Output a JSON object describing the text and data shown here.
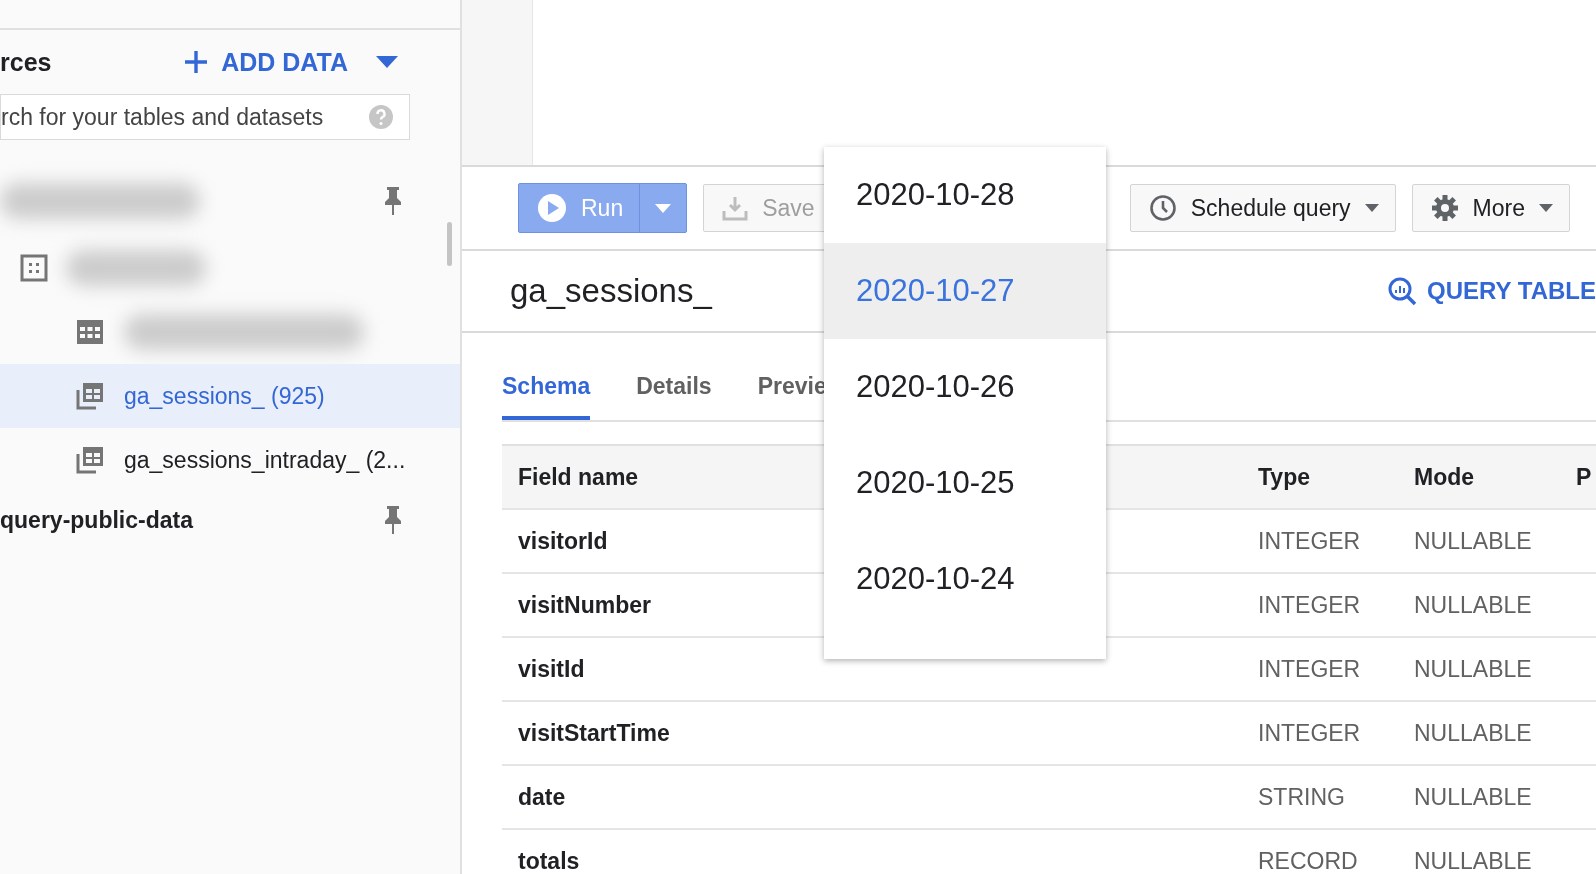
{
  "sidebar": {
    "title": "rces",
    "add_data": "ADD DATA",
    "search": {
      "placeholder": "rch for your tables and datasets"
    },
    "items": [
      {
        "kind": "project",
        "pinned": true,
        "blurred": true,
        "children": [
          {
            "kind": "dataset",
            "blurred": true,
            "children": [
              {
                "kind": "table",
                "blurred": true,
                "selected": false
              },
              {
                "kind": "sharded",
                "label": "ga_sessions_ (925)",
                "selected": true
              },
              {
                "kind": "sharded",
                "label": "ga_sessions_intraday_ (2...",
                "selected": false
              }
            ]
          }
        ]
      },
      {
        "kind": "project",
        "label": "query-public-data",
        "pinned": true
      }
    ]
  },
  "toolbar": {
    "run": "Run",
    "save": "Save",
    "schedule": "Schedule query",
    "more": "More"
  },
  "table_title": "ga_sessions_",
  "query_table": "QUERY TABLE",
  "tabs": [
    {
      "label": "Schema",
      "selected": true
    },
    {
      "label": "Details",
      "selected": false
    },
    {
      "label": "Previe",
      "selected": false
    }
  ],
  "schema": {
    "columns": [
      "Field name",
      "Type",
      "Mode",
      "P"
    ],
    "rows": [
      {
        "name": "visitorId",
        "type": "INTEGER",
        "mode": "NULLABLE"
      },
      {
        "name": "visitNumber",
        "type": "INTEGER",
        "mode": "NULLABLE"
      },
      {
        "name": "visitId",
        "type": "INTEGER",
        "mode": "NULLABLE"
      },
      {
        "name": "visitStartTime",
        "type": "INTEGER",
        "mode": "NULLABLE"
      },
      {
        "name": "date",
        "type": "STRING",
        "mode": "NULLABLE"
      },
      {
        "name": "totals",
        "type": "RECORD",
        "mode": "NULLABLE"
      }
    ]
  },
  "date_menu": [
    {
      "label": "2020-10-28",
      "selected": false
    },
    {
      "label": "2020-10-27",
      "selected": true
    },
    {
      "label": "2020-10-26",
      "selected": false
    },
    {
      "label": "2020-10-25",
      "selected": false
    },
    {
      "label": "2020-10-24",
      "selected": false
    }
  ]
}
